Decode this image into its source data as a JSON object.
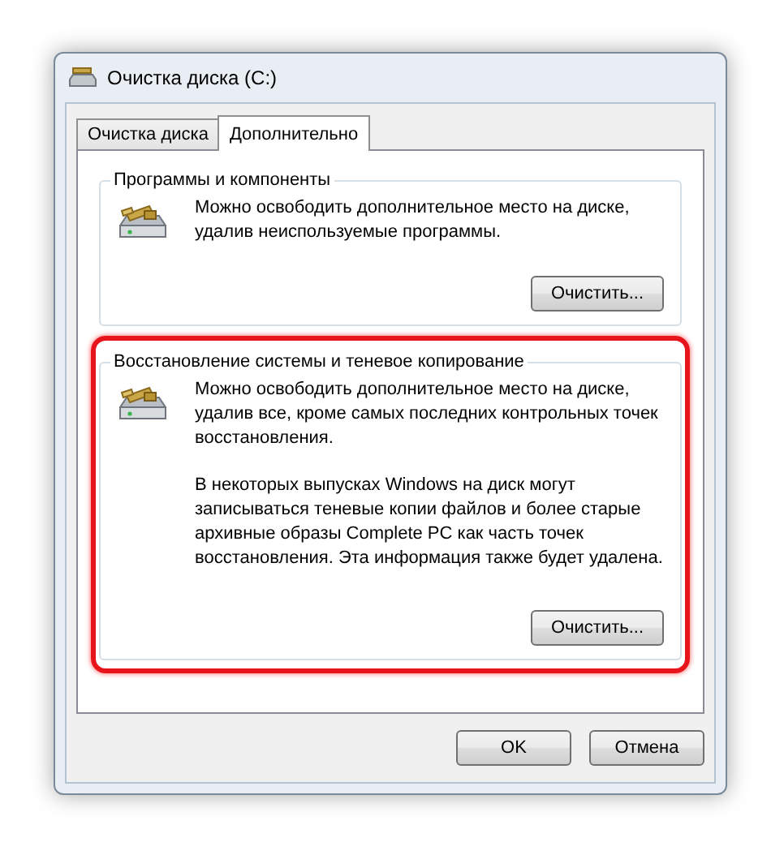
{
  "window": {
    "title": "Очистка диска  (C:)"
  },
  "tabs": [
    {
      "label": "Очистка диска",
      "selected": false
    },
    {
      "label": "Дополнительно",
      "selected": true
    }
  ],
  "sections": [
    {
      "title": "Программы и компоненты",
      "highlighted": false,
      "paragraphs": [
        "Можно освободить дополнительное место на диске,\nудалив неиспользуемые программы."
      ],
      "button": "Очистить..."
    },
    {
      "title": "Восстановление системы и теневое копирование",
      "highlighted": true,
      "paragraphs": [
        "Можно освободить дополнительное место на диске,\nудалив все, кроме самых последних контрольных точек\nвосстановления.",
        "В некоторых выпусках Windows на диск могут\nзаписываться теневые копии файлов и более старые\nархивные образы Complete PC как часть точек\nвосстановления. Эта информация также будет удалена."
      ],
      "button": "Очистить..."
    }
  ],
  "buttons": [
    "OK",
    "Отмена"
  ]
}
